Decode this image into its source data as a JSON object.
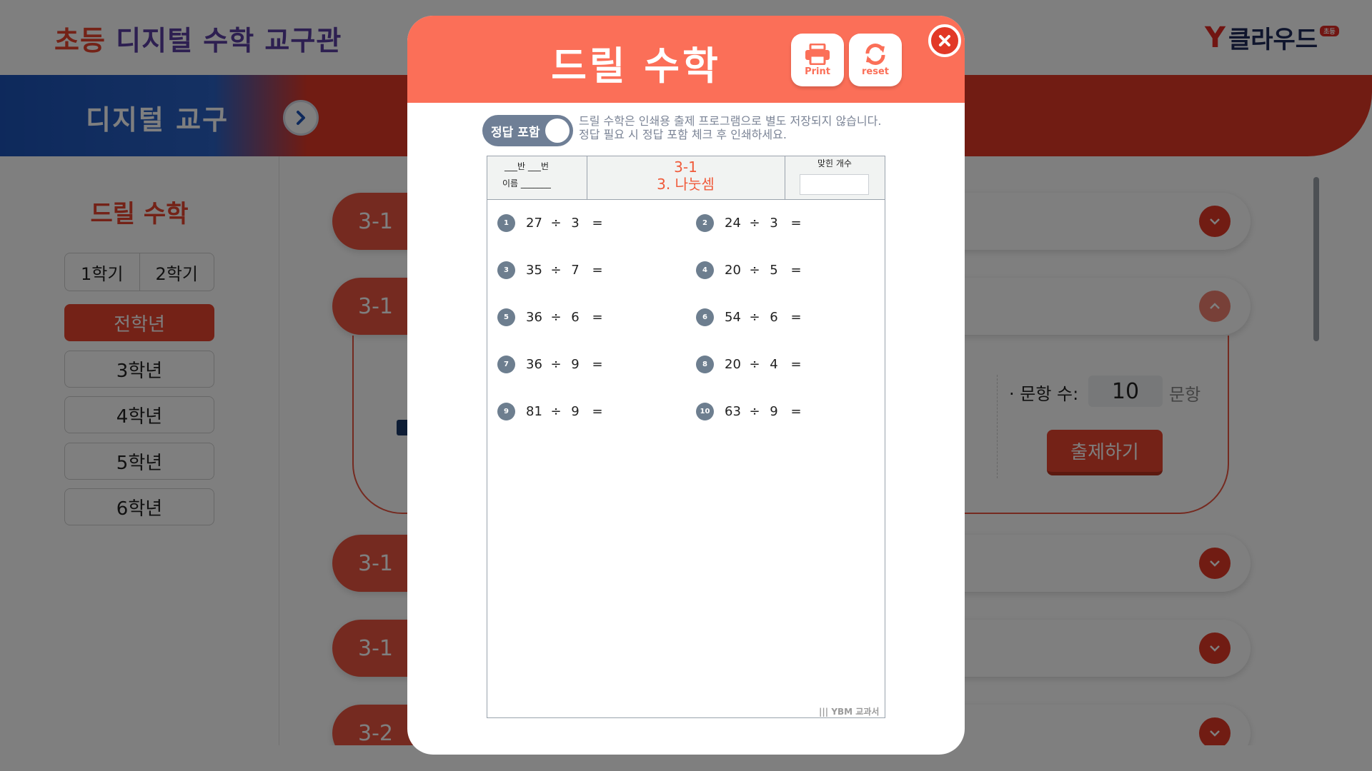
{
  "site": {
    "title_part1": "초등",
    "title_part2": "디지털 수학 교구관",
    "logo_text": "클라우드",
    "logo_badge": "초등"
  },
  "banner": {
    "title": "디지털 교구"
  },
  "sidebar": {
    "title": "드릴 수학",
    "semesters": [
      "1학기",
      "2학기"
    ],
    "grades": [
      {
        "label": "전학년",
        "active": true
      },
      {
        "label": "3학년",
        "active": false
      },
      {
        "label": "4학년",
        "active": false
      },
      {
        "label": "5학년",
        "active": false
      },
      {
        "label": "6학년",
        "active": false
      }
    ]
  },
  "accordion": {
    "items": [
      {
        "label": "3-1"
      },
      {
        "label": "3-1"
      },
      {
        "label": "3-1"
      },
      {
        "label": "3-1"
      },
      {
        "label": "3-2"
      }
    ],
    "panel": {
      "count_label": "· 문항 수:",
      "count_value": "10",
      "count_unit": "문항",
      "generate_label": "출제하기"
    }
  },
  "modal": {
    "title": "드릴 수학",
    "print_label": "Print",
    "reset_label": "reset",
    "toggle_label": "정답 포함",
    "toggle_on": false,
    "notice_line1": "드릴 수학은 인쇄용 출제 프로그램으로 별도 저장되지 않습니다.",
    "notice_line2": "정답 필요 시 정답 포함 체크 후 인쇄하세요.",
    "sheet": {
      "class_text": "___반  ___번",
      "name_text": "이름  _______",
      "unit_code": "3-1",
      "unit_name": "3. 나눗셈",
      "score_label": "맞힌 개수",
      "footer": "YBM 교과서",
      "problems": [
        {
          "no": "1",
          "a": "27",
          "op": "÷",
          "b": "3",
          "eq": "="
        },
        {
          "no": "2",
          "a": "24",
          "op": "÷",
          "b": "3",
          "eq": "="
        },
        {
          "no": "3",
          "a": "35",
          "op": "÷",
          "b": "7",
          "eq": "="
        },
        {
          "no": "4",
          "a": "20",
          "op": "÷",
          "b": "5",
          "eq": "="
        },
        {
          "no": "5",
          "a": "36",
          "op": "÷",
          "b": "6",
          "eq": "="
        },
        {
          "no": "6",
          "a": "54",
          "op": "÷",
          "b": "6",
          "eq": "="
        },
        {
          "no": "7",
          "a": "36",
          "op": "÷",
          "b": "9",
          "eq": "="
        },
        {
          "no": "8",
          "a": "20",
          "op": "÷",
          "b": "4",
          "eq": "="
        },
        {
          "no": "9",
          "a": "81",
          "op": "÷",
          "b": "9",
          "eq": "="
        },
        {
          "no": "10",
          "a": "63",
          "op": "÷",
          "b": "9",
          "eq": "="
        }
      ]
    }
  },
  "colors": {
    "accent": "#e8452f",
    "modal_header": "#fb6f58",
    "banner_blue": "#1c53b8"
  }
}
